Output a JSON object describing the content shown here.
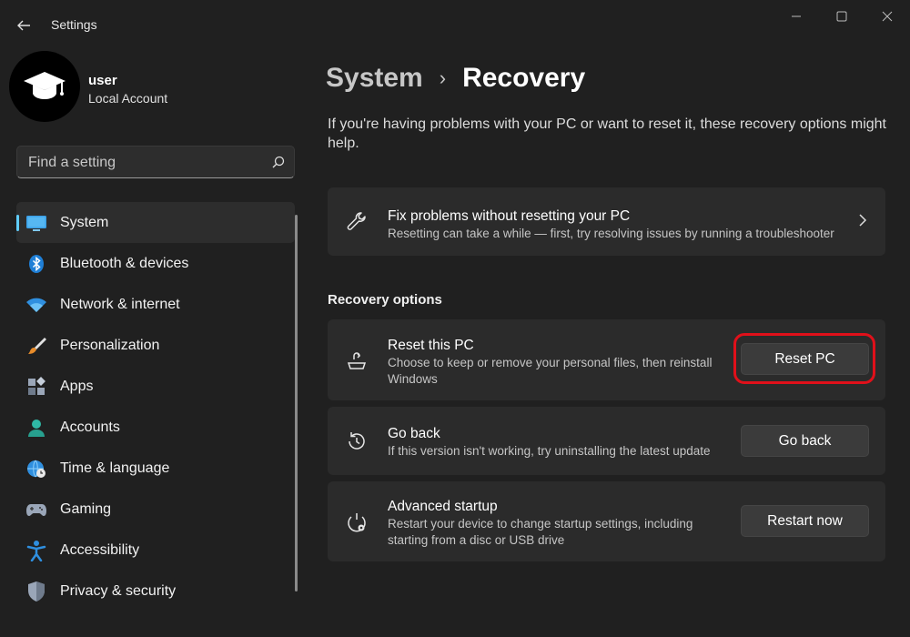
{
  "app": {
    "title": "Settings"
  },
  "profile": {
    "name": "user",
    "account_type": "Local Account"
  },
  "search": {
    "placeholder": "Find a setting"
  },
  "sidebar": {
    "items": [
      {
        "label": "System",
        "icon": "monitor-icon",
        "active": true
      },
      {
        "label": "Bluetooth & devices",
        "icon": "bluetooth-icon"
      },
      {
        "label": "Network & internet",
        "icon": "wifi-icon"
      },
      {
        "label": "Personalization",
        "icon": "brush-icon"
      },
      {
        "label": "Apps",
        "icon": "apps-icon"
      },
      {
        "label": "Accounts",
        "icon": "person-icon"
      },
      {
        "label": "Time & language",
        "icon": "globe-clock-icon"
      },
      {
        "label": "Gaming",
        "icon": "gamepad-icon"
      },
      {
        "label": "Accessibility",
        "icon": "accessibility-icon"
      },
      {
        "label": "Privacy & security",
        "icon": "shield-icon"
      }
    ]
  },
  "breadcrumb": {
    "parent": "System",
    "separator": "›",
    "current": "Recovery"
  },
  "intro": "If you're having problems with your PC or want to reset it, these recovery options might help.",
  "fix_card": {
    "title": "Fix problems without resetting your PC",
    "description": "Resetting can take a while — first, try resolving issues by running a troubleshooter"
  },
  "recovery_options": {
    "heading": "Recovery options",
    "items": [
      {
        "title": "Reset this PC",
        "description": "Choose to keep or remove your personal files, then reinstall Windows",
        "button": "Reset PC",
        "icon": "reset-pc-icon"
      },
      {
        "title": "Go back",
        "description": "If this version isn't working, try uninstalling the latest update",
        "button": "Go back",
        "icon": "history-icon"
      },
      {
        "title": "Advanced startup",
        "description": "Restart your device to change startup settings, including starting from a disc or USB drive",
        "button": "Restart now",
        "icon": "advanced-startup-icon"
      }
    ]
  },
  "colors": {
    "accent": "#60cdff",
    "highlight": "#e0101a",
    "background": "#202020",
    "card": "#2b2b2b"
  }
}
